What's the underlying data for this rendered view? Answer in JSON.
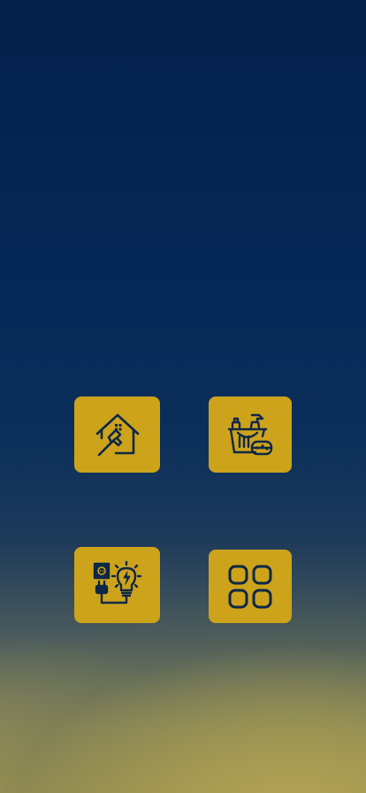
{
  "colors": {
    "tile_background": "#cda31c",
    "icon_stroke": "#0d2747",
    "background_top": "#03204a",
    "background_bottom": "#a89f55"
  },
  "services": [
    {
      "id": "home-repair",
      "icon": "house-hammer-icon",
      "label": ""
    },
    {
      "id": "cleaning",
      "icon": "cleaning-supplies-icon",
      "label": ""
    },
    {
      "id": "electrical",
      "icon": "plug-lightbulb-icon",
      "label": ""
    },
    {
      "id": "more",
      "icon": "grid-icon",
      "label": ""
    }
  ]
}
